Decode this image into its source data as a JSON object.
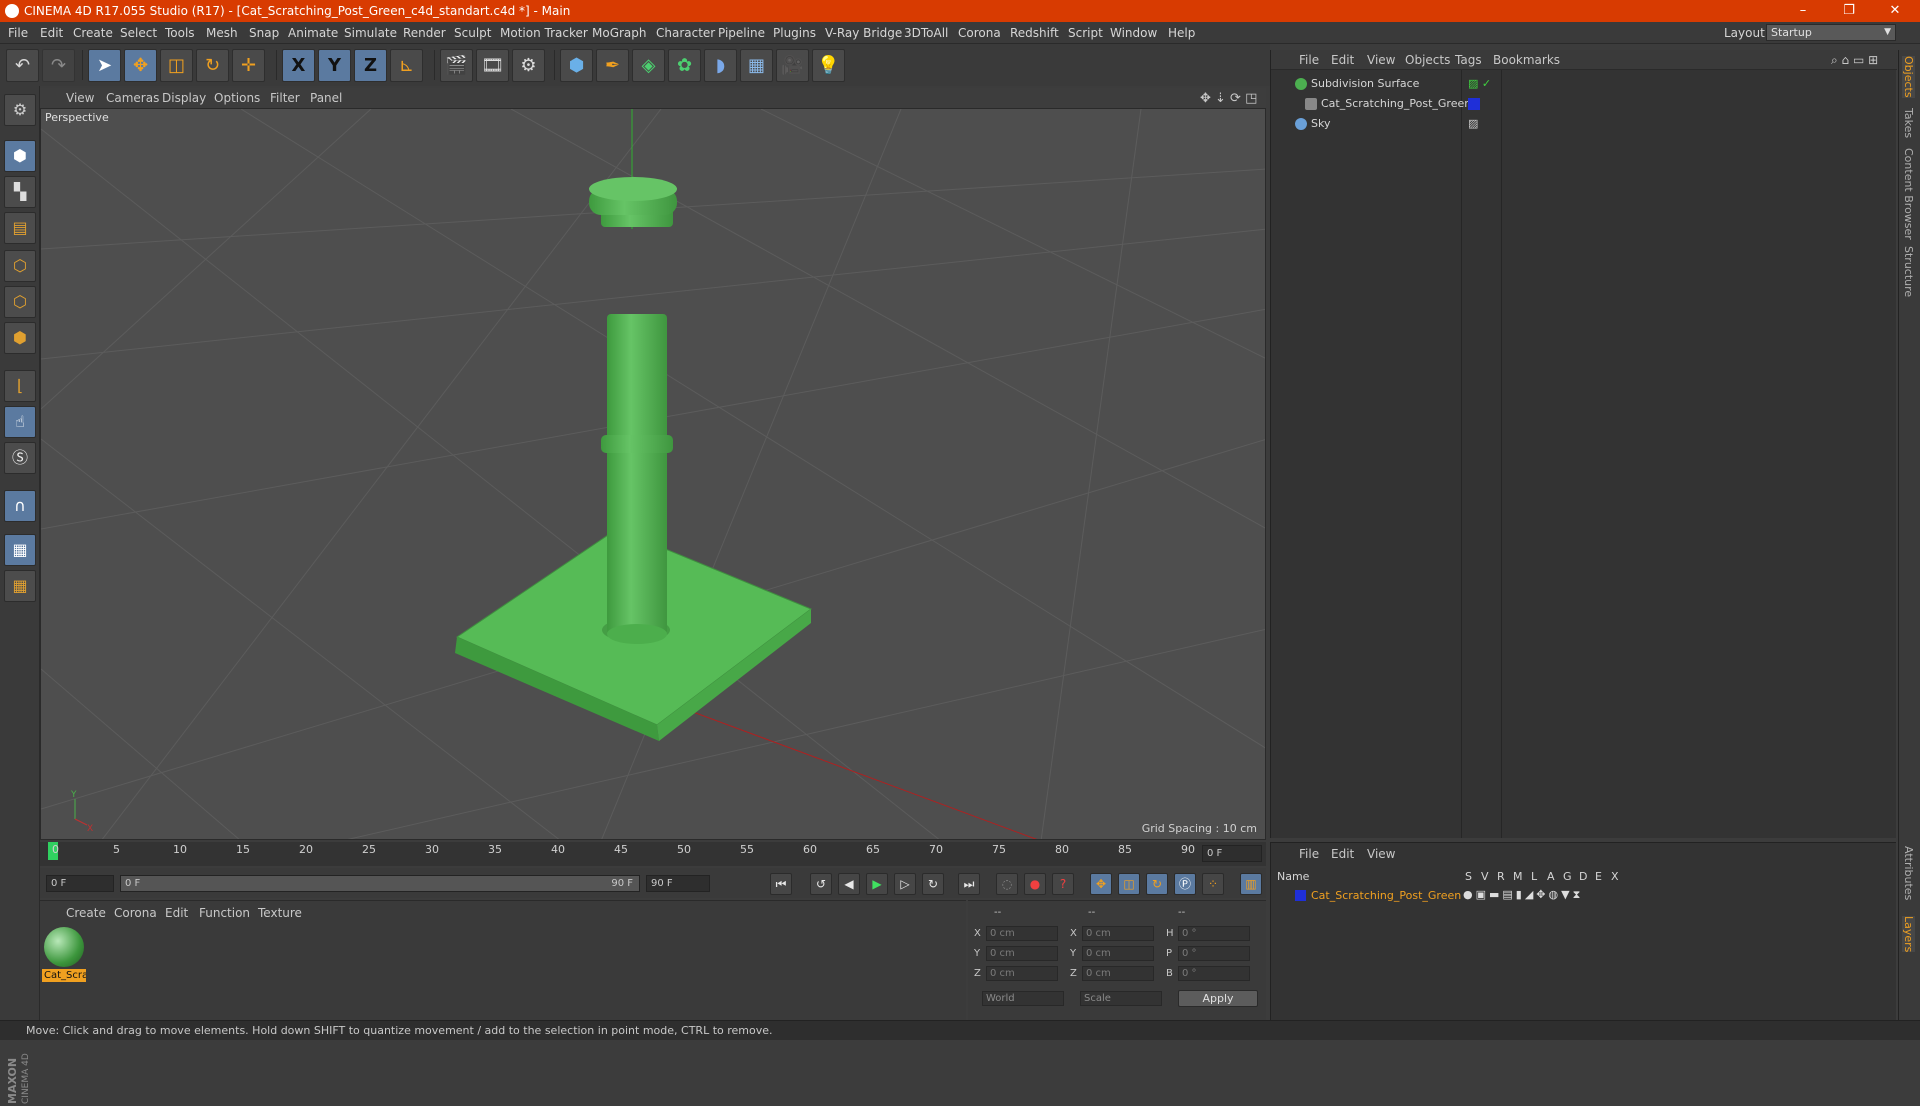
{
  "window": {
    "title": "CINEMA 4D R17.055 Studio (R17) - [Cat_Scratching_Post_Green_c4d_standart.c4d *] - Main",
    "controls": [
      "–",
      "❐",
      "✕"
    ]
  },
  "menubar": {
    "items": [
      "File",
      "Edit",
      "Create",
      "Select",
      "Tools",
      "Mesh",
      "Snap",
      "Animate",
      "Simulate",
      "Render",
      "Sculpt",
      "Motion Tracker",
      "MoGraph",
      "Character",
      "Pipeline",
      "Plugins",
      "V-Ray Bridge",
      "3DToAll",
      "Corona",
      "Redshift",
      "Script",
      "Window",
      "Help"
    ],
    "layout_label": "Layout:",
    "layout_value": "Startup"
  },
  "toolbar": {
    "axis_x": "X",
    "axis_y": "Y",
    "axis_z": "Z"
  },
  "viewport": {
    "menu": [
      "View",
      "Cameras",
      "Display",
      "Options",
      "Filter",
      "Panel"
    ],
    "label": "Perspective",
    "grid_spacing": "Grid Spacing : 10 cm",
    "axis_y": "Y",
    "axis_x": "X",
    "colors": {
      "object": "#4ab04a",
      "bg": "#4e4e4e"
    }
  },
  "timeline": {
    "ticks": [
      "0",
      "5",
      "10",
      "15",
      "20",
      "25",
      "30",
      "35",
      "40",
      "45",
      "50",
      "55",
      "60",
      "65",
      "70",
      "75",
      "80",
      "85",
      "90"
    ],
    "current_frame": "0 F"
  },
  "playback": {
    "start_field": "0 F",
    "range_start": "0 F",
    "range_end": "90 F",
    "end_field": "90 F"
  },
  "material_manager": {
    "menu": [
      "Create",
      "Corona",
      "Edit",
      "Function",
      "Texture"
    ],
    "material_name": "Cat_Scra"
  },
  "coordinates": {
    "headers": [
      "--",
      "--",
      "--"
    ],
    "rows": [
      {
        "l1": "X",
        "v1": "0 cm",
        "l2": "X",
        "v2": "0 cm",
        "l3": "H",
        "v3": "0 °"
      },
      {
        "l1": "Y",
        "v1": "0 cm",
        "l2": "Y",
        "v2": "0 cm",
        "l3": "P",
        "v3": "0 °"
      },
      {
        "l1": "Z",
        "v1": "0 cm",
        "l2": "Z",
        "v2": "0 cm",
        "l3": "B",
        "v3": "0 °"
      }
    ],
    "world": "World",
    "scale": "Scale",
    "apply": "Apply"
  },
  "object_manager": {
    "menu": [
      "File",
      "Edit",
      "View",
      "Objects",
      "Tags",
      "Bookmarks"
    ],
    "objects": [
      {
        "name": "Subdivision Surface",
        "color": "#4caf50"
      },
      {
        "name": "Cat_Scratching_Post_Green",
        "color": "#888888"
      },
      {
        "name": "Sky",
        "color": "#6aa0d8"
      }
    ]
  },
  "layer_manager": {
    "menu": [
      "File",
      "Edit",
      "View"
    ],
    "columns": [
      "Name",
      "S",
      "V",
      "R",
      "M",
      "L",
      "A",
      "G",
      "D",
      "E",
      "X"
    ],
    "layer_name": "Cat_Scratching_Post_Green",
    "layer_color": "#1f2fd8"
  },
  "right_tabs": [
    "Objects",
    "Takes",
    "Content Browser",
    "Structure",
    "Attributes",
    "Layers"
  ],
  "maxon": {
    "brand": "MAXON",
    "product": "CINEMA 4D"
  },
  "status": "Move: Click and drag to move elements. Hold down SHIFT to quantize movement / add to the selection in point mode, CTRL to remove."
}
